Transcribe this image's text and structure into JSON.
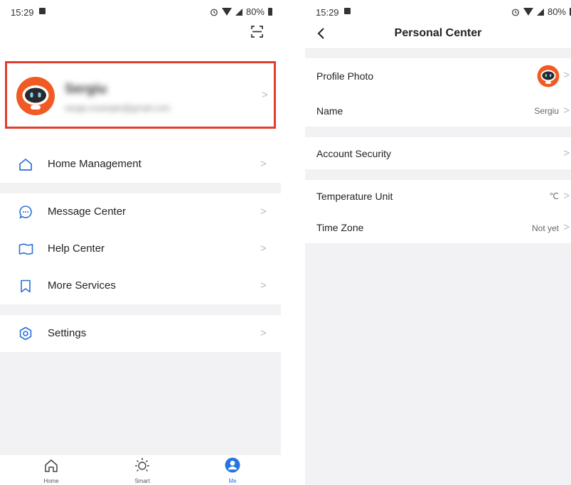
{
  "colors": {
    "highlight": "#e23c2e",
    "accent": "#2575e0",
    "avatar": "#f15a22",
    "background": "#f2f2f4"
  },
  "status": {
    "time": "15:29",
    "battery": "80%"
  },
  "me": {
    "profile": {
      "name": "Sergiu",
      "email": "sergiu.example@gmail.com"
    },
    "menu": [
      {
        "label": "Home Management",
        "icon": "home-icon"
      },
      {
        "label": "Message Center",
        "icon": "message-icon"
      },
      {
        "label": "Help Center",
        "icon": "book-icon"
      },
      {
        "label": "More Services",
        "icon": "bookmark-icon"
      },
      {
        "label": "Settings",
        "icon": "settings-icon"
      }
    ],
    "tabs": [
      {
        "label": "Home",
        "icon": "home-outline-icon"
      },
      {
        "label": "Smart",
        "icon": "sun-icon"
      },
      {
        "label": "Me",
        "icon": "person-icon",
        "active": true
      }
    ]
  },
  "personal": {
    "title": "Personal Center",
    "rows": [
      {
        "label": "Profile Photo",
        "value": ""
      },
      {
        "label": "Name",
        "value": "Sergiu"
      },
      {
        "label": "Account Security",
        "value": ""
      },
      {
        "label": "Temperature Unit",
        "value": "℃"
      },
      {
        "label": "Time Zone",
        "value": "Not yet"
      }
    ]
  }
}
